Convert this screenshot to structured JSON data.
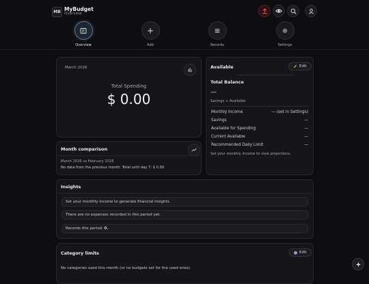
{
  "header": {
    "logo_text": "MB",
    "app_name": "MyBudget",
    "app_subtitle": "Overview",
    "icons": [
      "upload-icon",
      "eye-icon",
      "search-icon",
      "user-icon"
    ]
  },
  "nav": {
    "items": [
      {
        "label": "Overview",
        "icon": "overview-icon",
        "active": true
      },
      {
        "label": "Add",
        "icon": "plus-icon",
        "active": false
      },
      {
        "label": "Records",
        "icon": "list-icon",
        "active": false
      },
      {
        "label": "Settings",
        "icon": "gear-icon",
        "active": false
      }
    ]
  },
  "spending": {
    "period": "March 2026",
    "title": "Total Spending",
    "amount": "$ 0.00"
  },
  "comparison": {
    "title": "Month comparison",
    "subtitle": "March 2026 vs February 2026",
    "note": "No data from the previous month. Total until day 7: $ 0.00"
  },
  "available": {
    "title": "Available",
    "edit_label": "Edit",
    "balance_title": "Total Balance",
    "balance_value": "—",
    "balance_caption": "Savings + Available",
    "rows": [
      {
        "label": "Monthly Income",
        "value": "— (set in Settings)"
      },
      {
        "label": "Savings",
        "value": "—"
      },
      {
        "label": "Available for Spending",
        "value": "—"
      },
      {
        "label": "Current Available",
        "value": "—"
      },
      {
        "label": "Recommended Daily Limit",
        "value": "—"
      }
    ],
    "hint": "Set your monthly income to view projections."
  },
  "insights": {
    "title": "Insights",
    "items": [
      "Set your monthly income to generate financial insights.",
      "There are no expenses recorded in this period yet."
    ],
    "records_label": "Records this period:",
    "records_count": "0."
  },
  "category": {
    "title": "Category limits",
    "edit_label": "Edit",
    "note": "No categories used this month (or no budgets set for the used ones)."
  },
  "colors": {
    "background": "#0e0e10",
    "card": "#161618",
    "upload_accent": "#e0475e",
    "edit_accent": "#e8b04a",
    "category_dot": "#8aa0c8"
  }
}
